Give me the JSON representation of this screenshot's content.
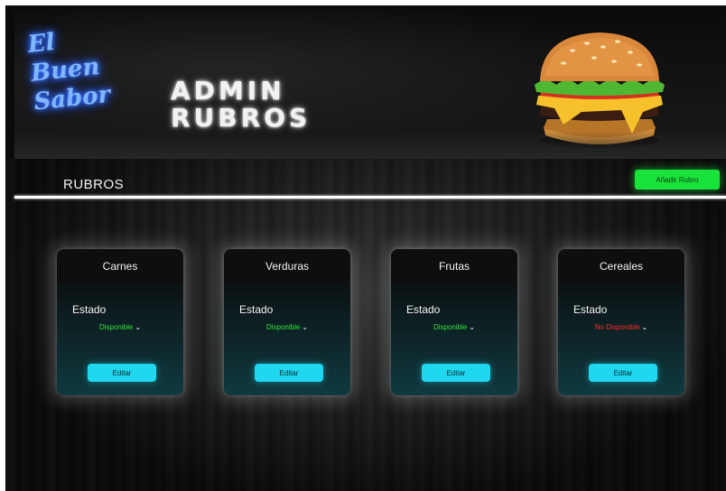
{
  "header": {
    "logo_text": "El Buen Sabor",
    "title_line1": "ADMIN",
    "title_line2": "RUBROS"
  },
  "section": {
    "title": "RUBROS",
    "add_button_label": "Añadir Rubro"
  },
  "cards": [
    {
      "name": "Carnes",
      "estado_label": "Estado",
      "estado_value": "Disponible",
      "estado_color": "#32e23b",
      "edit_label": "Editar"
    },
    {
      "name": "Verduras",
      "estado_label": "Estado",
      "estado_value": "Disponible",
      "estado_color": "#32e23b",
      "edit_label": "Editar"
    },
    {
      "name": "Frutas",
      "estado_label": "Estado",
      "estado_value": "Disponible",
      "estado_color": "#32e23b",
      "edit_label": "Editar"
    },
    {
      "name": "Cereales",
      "estado_label": "Estado",
      "estado_value": "No Disponible",
      "estado_color": "#ff2b2b",
      "edit_label": "Editar"
    }
  ],
  "colors": {
    "accent_green": "#19e33a",
    "accent_cyan": "#1fd7ef",
    "logo_neon_blue": "#7fb6ff"
  },
  "icons": {
    "dropdown": "chevron-down-icon",
    "banner_image": "burger-image"
  }
}
